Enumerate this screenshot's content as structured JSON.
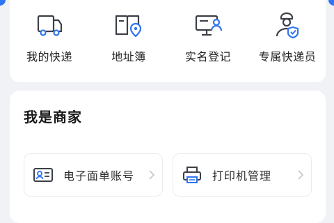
{
  "services": [
    {
      "label": "我的快递",
      "icon": "delivery-truck-icon"
    },
    {
      "label": "地址簿",
      "icon": "address-book-icon"
    },
    {
      "label": "实名登记",
      "icon": "id-monitor-icon"
    },
    {
      "label": "专属快递员",
      "icon": "courier-icon"
    }
  ],
  "merchant": {
    "title": "我是商家",
    "tiles": [
      {
        "label": "电子面单账号",
        "icon": "id-card-icon"
      },
      {
        "label": "打印机管理",
        "icon": "printer-icon"
      }
    ]
  },
  "colors": {
    "accent": "#2f74f0",
    "icon_stroke": "#3b3f47"
  }
}
